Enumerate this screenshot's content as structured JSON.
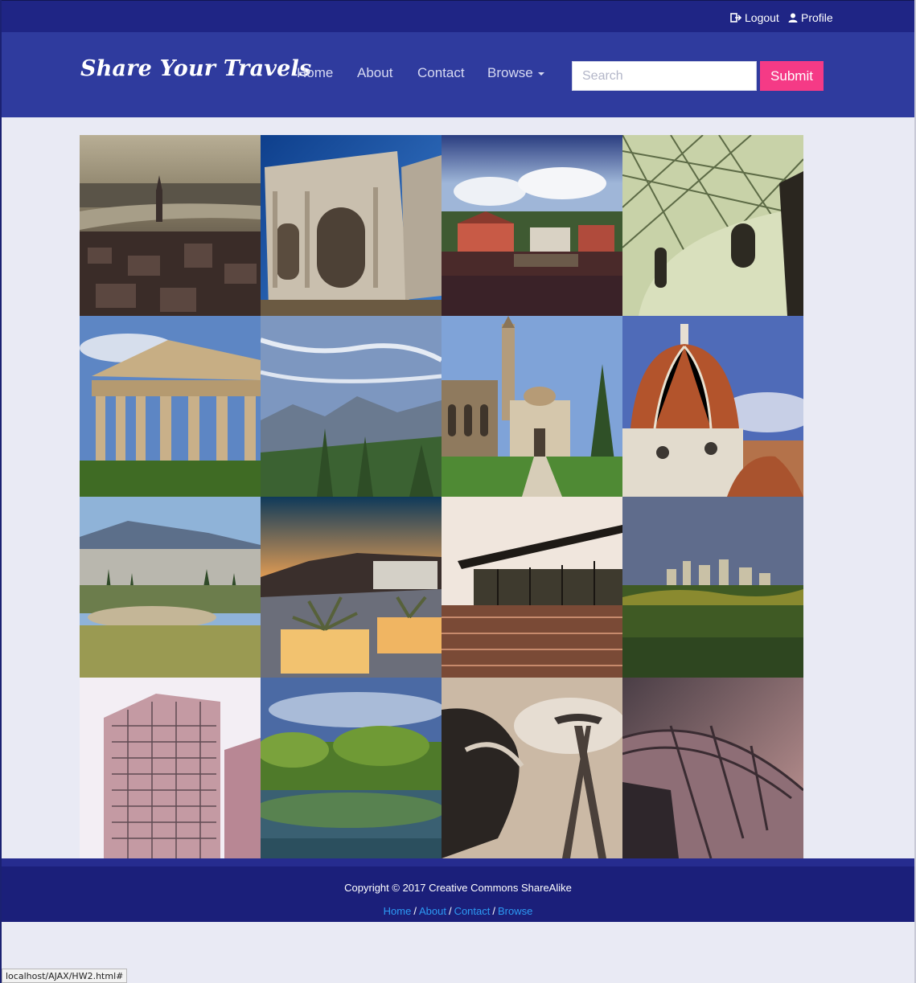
{
  "topbar": {
    "logout_label": "Logout",
    "logout_icon": "logout-icon",
    "profile_label": "Profile",
    "profile_icon": "user-icon"
  },
  "header": {
    "brand": "Share Your Travels",
    "nav": {
      "home": "Home",
      "about": "About",
      "contact": "Contact",
      "browse": "Browse"
    },
    "search": {
      "placeholder": "Search",
      "value": ""
    },
    "submit_label": "Submit"
  },
  "gallery": {
    "rows": 4,
    "columns": 4,
    "tiles": [
      "city-river-aerial-photo",
      "roman-triumphal-arch-photo",
      "harbor-red-houses-photo",
      "museum-dome-lattice-photo",
      "greek-temple-photo",
      "mountain-valley-photo",
      "church-courtyard-photo",
      "cathedral-dome-photo",
      "ancient-theater-city-photo",
      "terrace-plants-dusk-photo",
      "glass-pavilion-photo",
      "skyline-trees-photo",
      "glass-tower-photo",
      "lake-park-photo",
      "space-needle-photo",
      "curved-roof-structure-photo"
    ]
  },
  "footer": {
    "copyright": "Copyright © 2017 Creative Commons ShareAlike",
    "links": {
      "home": "Home",
      "about": "About",
      "contact": "Contact",
      "browse": "Browse"
    },
    "separator": "/"
  },
  "statusbar": {
    "url": "localhost/AJAX/HW2.html#"
  },
  "colors": {
    "topbar": "#1f2585",
    "header": "#2f3b9e",
    "accent_button": "#f53a86",
    "footer": "#1b1f7a",
    "footer_link": "#2c9af4",
    "page_background": "#e9eaf4"
  }
}
